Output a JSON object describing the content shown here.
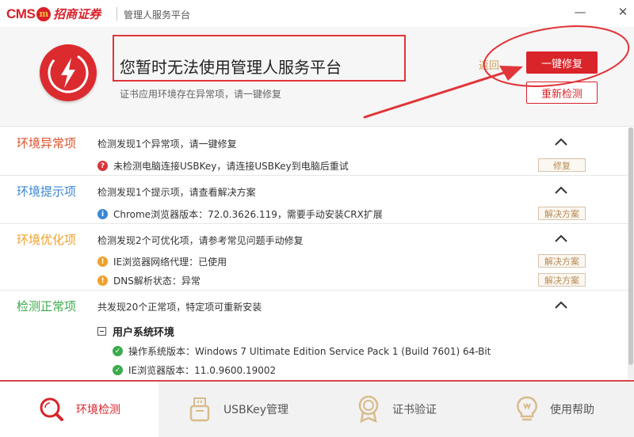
{
  "titlebar": {
    "logo_cms": "CMS",
    "logo_badge": "m",
    "logo_name": "招商证券",
    "app_title": "管理人服务平台",
    "minimize_glyph": "—",
    "close_glyph": "✕"
  },
  "header": {
    "headline": "您暂时无法使用管理人服务平台",
    "subline": "证书应用环境存在异常项，请一键修复",
    "back_label": "返回",
    "repair_label": "一键修复",
    "recheck_label": "重新检测",
    "alert_icon": "lightning-icon"
  },
  "sections": {
    "abnormal": {
      "title": "环境异常项",
      "summary": "检测发现1个异常项，请一键修复",
      "items": [
        {
          "icon": "error-icon",
          "text": "未检测电脑连接USBKey，请连接USBKey到电脑后重试",
          "action": "修复"
        }
      ]
    },
    "hint": {
      "title": "环境提示项",
      "summary": "检测发现1个提示项，请查看解决方案",
      "items": [
        {
          "icon": "info-icon",
          "text": "Chrome浏览器版本：72.0.3626.119，需要手动安装CRX扩展",
          "action": "解决方案"
        }
      ]
    },
    "optimize": {
      "title": "环境优化项",
      "summary": "检测发现2个可优化项，请参考常见问题手动修复",
      "items": [
        {
          "icon": "warning-icon",
          "text": "IE浏览器网络代理：已使用",
          "action": "解决方案"
        },
        {
          "icon": "warning-icon",
          "text": "DNS解析状态：异常",
          "action": "解决方案"
        }
      ]
    },
    "normal": {
      "title": "检测正常项",
      "summary": "共发现20个正常项，特定项可重新安装",
      "group_label": "用户系统环境",
      "items": [
        {
          "icon": "check-icon",
          "text": "操作系统版本：Windows 7 Ultimate Edition Service Pack 1 (Build 7601) 64-Bit"
        },
        {
          "icon": "check-icon",
          "text": "IE浏览器版本：11.0.9600.19002"
        }
      ]
    }
  },
  "tabs": [
    {
      "label": "环境检测",
      "icon": "magnifier-icon",
      "active": true
    },
    {
      "label": "USBKey管理",
      "icon": "usb-key-icon",
      "active": false
    },
    {
      "label": "证书验证",
      "icon": "certificate-icon",
      "active": false
    },
    {
      "label": "使用帮助",
      "icon": "lightbulb-icon",
      "active": false
    }
  ],
  "colors": {
    "brand_red": "#d9242a",
    "abnormal": "#e0502a",
    "hint": "#3a87d6",
    "optimize": "#f0a02a",
    "normal": "#3bab4c",
    "annotation": "#e1353a"
  }
}
